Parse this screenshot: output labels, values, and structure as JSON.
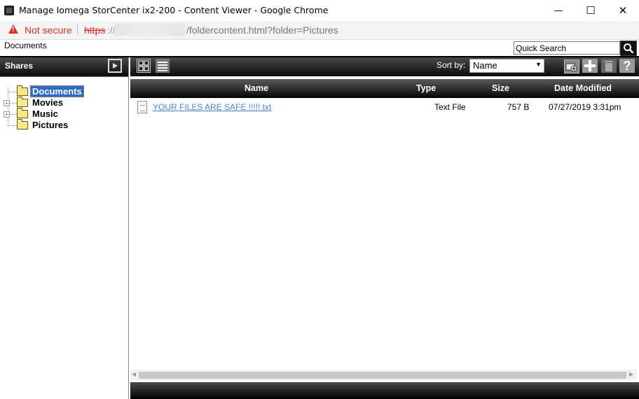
{
  "window": {
    "title": "Manage Iomega StorCenter ix2-200 - Content Viewer - Google Chrome",
    "minimize_glyph": "—",
    "maximize_glyph": "☐",
    "close_glyph": "✕"
  },
  "address_bar": {
    "security_label": "Not secure",
    "url_scheme": "https",
    "url_separator": "://",
    "url_path": "/foldercontent.html?folder=Pictures",
    "warning_glyph": "!"
  },
  "breadcrumb": "Documents",
  "quick_search": {
    "placeholder": "Quick Search",
    "value": "Quick Search"
  },
  "sidebar": {
    "title": "Shares",
    "items": [
      {
        "label": "Documents",
        "selected": true,
        "expandable": false
      },
      {
        "label": "Movies",
        "selected": false,
        "expandable": true
      },
      {
        "label": "Music",
        "selected": false,
        "expandable": true
      },
      {
        "label": "Pictures",
        "selected": false,
        "expandable": false
      }
    ]
  },
  "toolbar": {
    "sort_label": "Sort by:",
    "sort_value": "Name",
    "icons": [
      "grid-view-icon",
      "list-view-icon",
      "new-folder-icon",
      "add-icon",
      "trash-icon",
      "help-icon"
    ]
  },
  "table": {
    "columns": [
      "Name",
      "Type",
      "Size",
      "Date Modified"
    ],
    "rows": [
      {
        "name": "YOUR FILES ARE SAFE !!!!!.txt",
        "type": "Text File",
        "size": "757 B",
        "modified": "07/27/2019 3:31pm"
      }
    ]
  },
  "colors": {
    "accent_selected": "#316ac5",
    "link": "#4a82cc",
    "warning": "#d93025"
  }
}
